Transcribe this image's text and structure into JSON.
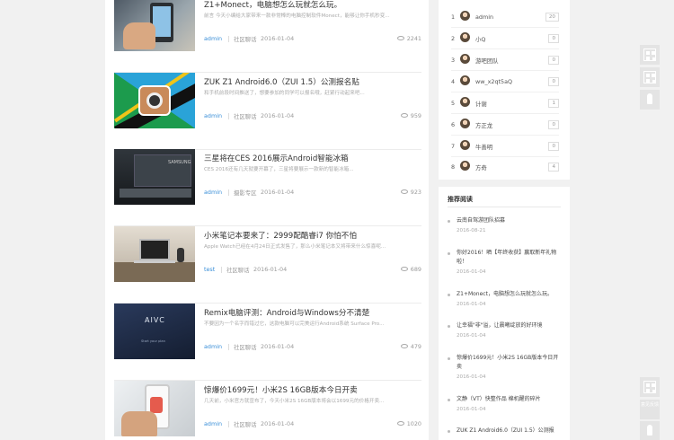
{
  "posts": [
    {
      "title": "Z1+Monect，电脑想怎么玩就怎么玩。",
      "excerpt": "前言 今天小编给大家带来一款非常棒的电脑控制软件Monect，能够让你手机秒变...",
      "author": "admin",
      "category": "社区聊话",
      "date": "2016-01-04",
      "views": "2241",
      "thumb": "phone-in-hand"
    },
    {
      "title": "ZUK Z1 Android6.0（ZUI 1.5）公测报名贴",
      "excerpt": "和手机前段时间推送了，想要参加的同学可以报名哦，赶紧行动起来吧...",
      "author": "admin",
      "category": "社区聊话",
      "date": "2016-01-04",
      "views": "959",
      "thumb": "camera-on-flag"
    },
    {
      "title": "三星将在CES 2016展示Android智能冰箱",
      "excerpt": "CES 2016还有几天就要开幕了，三星将要展示一款新的智能冰箱...",
      "author": "admin",
      "category": "摄影专区",
      "date": "2016-01-04",
      "views": "923",
      "thumb": "samsung-tv"
    },
    {
      "title": "小米笔记本要来了：2999配酷睿i7 你怕不怕",
      "excerpt": "Apple Watch已经在4月24日正式发售了，那么小米笔记本又将带来什么惊喜呢...",
      "author": "test",
      "category": "社区聊话",
      "date": "2016-01-04",
      "views": "689",
      "thumb": "desk-laptop"
    },
    {
      "title": "Remix电脑评测：Android与Windows分不清楚",
      "excerpt": "不要因为一个名字而错过它，这款电脑可以完美运行Android系统 Surface Pro...",
      "author": "admin",
      "category": "社区聊话",
      "date": "2016-01-04",
      "views": "479",
      "thumb": "aivc-screen"
    },
    {
      "title": "惊爆价1699元！小米2S 16GB版本今日开卖",
      "excerpt": "几天前，小米官方就宣布了，今天小米2S 16GB版本将会以1699元的价格开卖...",
      "author": "admin",
      "category": "社区聊话",
      "date": "2016-01-04",
      "views": "1020",
      "thumb": "hand-phone-white"
    }
  ],
  "thumb_texts": {
    "samsung": "SAMSUNG",
    "aivc": "AIVC",
    "aivc_sub": "Start your plan"
  },
  "ranking": [
    {
      "rank": "1",
      "name": "admin",
      "count": "20"
    },
    {
      "rank": "2",
      "name": "小Q",
      "count": "0"
    },
    {
      "rank": "3",
      "name": "游吧团队",
      "count": "0"
    },
    {
      "rank": "4",
      "name": "ww_x2qt5aQ",
      "count": "0"
    },
    {
      "rank": "5",
      "name": "计谢",
      "count": "1"
    },
    {
      "rank": "6",
      "name": "方正龙",
      "count": "0"
    },
    {
      "rank": "7",
      "name": "牛善明",
      "count": "0"
    },
    {
      "rank": "8",
      "name": "方奇",
      "count": "4"
    }
  ],
  "recommended": {
    "title": "推荐阅读",
    "items": [
      {
        "title": "云南自驾游团队招募",
        "date": "2016-08-21"
      },
      {
        "title": "你好2016！晒【年终收获】赢取新年礼物啦！",
        "date": "2016-01-04"
      },
      {
        "title": "Z1+Monect，电脑想怎么玩就怎么玩。",
        "date": "2016-01-04"
      },
      {
        "title": "让幸福\"非\"溢，让晨曦绽放的好环境",
        "date": "2016-01-04"
      },
      {
        "title": "惊爆价1699元！小米2S 16GB版本今日开卖",
        "date": "2016-01-04"
      },
      {
        "title": "文静（VT）快整作品 棉机醒的碎片",
        "date": "2016-01-04"
      },
      {
        "title": "ZUK Z1 Android6.0（ZUI 1.5）公测报",
        "date": ""
      }
    ]
  },
  "float_buttons": {
    "feedback_label": "意见反馈"
  }
}
